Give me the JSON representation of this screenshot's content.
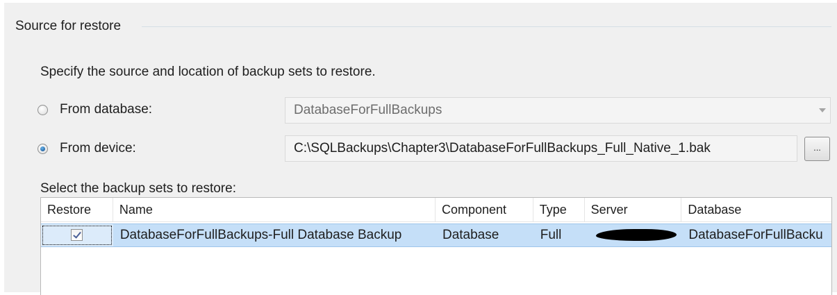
{
  "group": {
    "title": "Source for restore"
  },
  "instruction": "Specify the source and location of backup sets to restore.",
  "from_database": {
    "label": "From database:",
    "checked": false,
    "selected_value": "DatabaseForFullBackups"
  },
  "from_device": {
    "label": "From device:",
    "checked": true,
    "path": "C:\\SQLBackups\\Chapter3\\DatabaseForFullBackups_Full_Native_1.bak",
    "browse_label": "..."
  },
  "backup_sets": {
    "label": "Select the backup sets to restore:",
    "columns": [
      "Restore",
      "Name",
      "Component",
      "Type",
      "Server",
      "Database"
    ],
    "rows": [
      {
        "restore": true,
        "name": "DatabaseForFullBackups-Full Database Backup",
        "component": "Database",
        "type": "Full",
        "server": "",
        "database": "DatabaseForFullBacku"
      }
    ]
  },
  "colors": {
    "panel_bg": "#f0f0f0",
    "selected_row": "#c5dff8",
    "radio_checked": "#1e5c9c"
  }
}
